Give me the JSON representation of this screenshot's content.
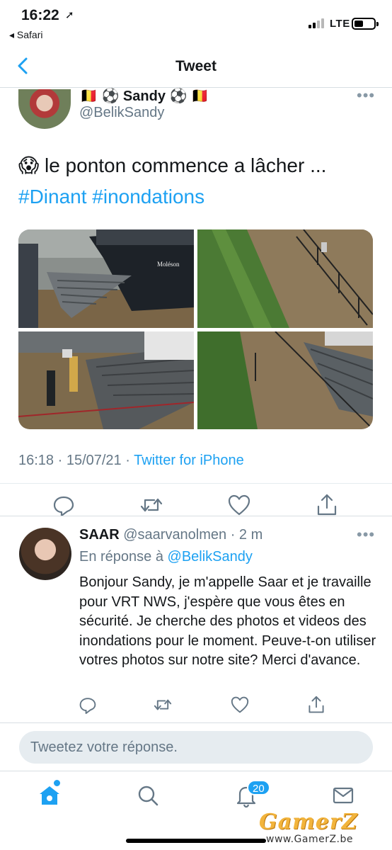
{
  "status_bar": {
    "time": "16:22",
    "location_arrow": "➚",
    "back_app": "◂ Safari",
    "network": "LTE"
  },
  "nav": {
    "title": "Tweet",
    "back_icon": "chevron-left-icon"
  },
  "tweet": {
    "author_name": "🇧🇪 ⚽ Sandy ⚽ 🇧🇪",
    "author_handle": "@BelikSandy",
    "text_emoji": "😱",
    "text": " le ponton commence a lâcher ...",
    "hashtags": "#Dinant #inondations",
    "timestamp": "16:18 · 15/07/21 · ",
    "source": "Twitter for iPhone",
    "photo_label": "Moléson"
  },
  "reply": {
    "author_name": "SAAR",
    "author_meta": " @saarvanolmen · 2 m",
    "reply_to_prefix": "En réponse à ",
    "reply_to_handle": "@BelikSandy",
    "text": "Bonjour Sandy, je m'appelle Saar et je travaille pour VRT NWS, j'espère que vous êtes en sécurité. Je cherche des photos et videos des inondations pour le moment. Peuve-t-on utiliser votres photos sur notre site? Merci d'avance."
  },
  "composer": {
    "placeholder": "Tweetez votre réponse."
  },
  "tabbar": {
    "notification_count": "20"
  },
  "watermark": {
    "brand": "GamerZ",
    "url": "www.GamerZ.be"
  },
  "colors": {
    "accent": "#1da1f2",
    "secondary_text": "#657786",
    "divider": "#d8dee2"
  }
}
